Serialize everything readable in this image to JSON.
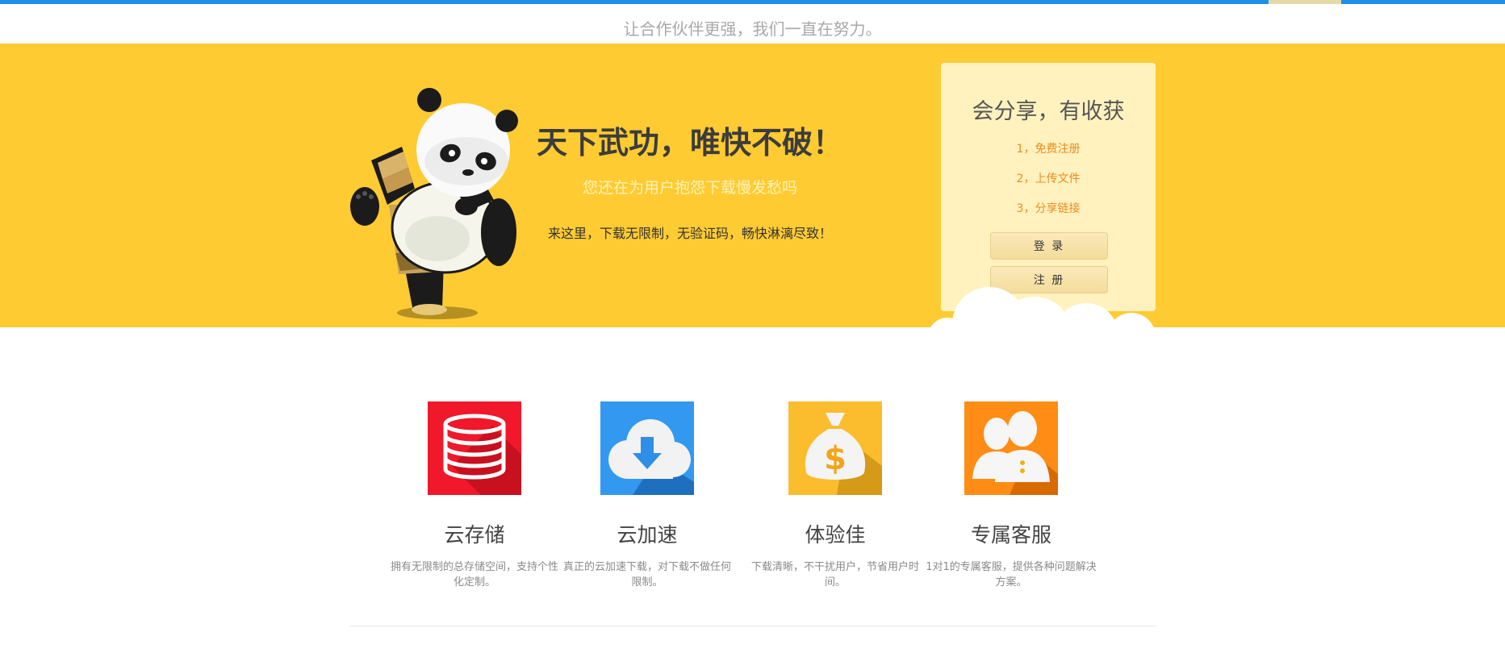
{
  "header": {
    "tagline": "让合作伙伴更强，我们一直在努力。"
  },
  "banner": {
    "headline": "天下武功，唯快不破！",
    "subline": "您还在为用户抱怨下载慢发愁吗",
    "desc": "来这里，下载无限制，无验证码，畅快淋漓尽致！"
  },
  "login_card": {
    "title": "会分享，有收获",
    "steps": [
      "1，免费注册",
      "2，上传文件",
      "3，分享链接"
    ],
    "login_label": "登 录",
    "register_label": "注 册"
  },
  "features": [
    {
      "icon": "database-icon",
      "title": "云存储",
      "desc": "拥有无限制的总存储空间，支持个性化定制。"
    },
    {
      "icon": "cloud-download-icon",
      "title": "云加速",
      "desc": "真正的云加速下载，对下载不做任何限制。"
    },
    {
      "icon": "money-bag-icon",
      "title": "体验佳",
      "desc": "下载清晰，不干扰用户，节省用户时间。"
    },
    {
      "icon": "customer-service-icon",
      "title": "专属客服",
      "desc": "1对1的专属客服，提供各种问题解决方案。"
    }
  ],
  "colors": {
    "top_bar": "#1e90e8",
    "banner": "#ffcb33",
    "card": "#fff2bf",
    "step_text": "#f08a1c",
    "feature_red": "#f0182a",
    "feature_blue": "#3399f0",
    "feature_yellow": "#fbbd2e",
    "feature_orange": "#ff8c14"
  }
}
